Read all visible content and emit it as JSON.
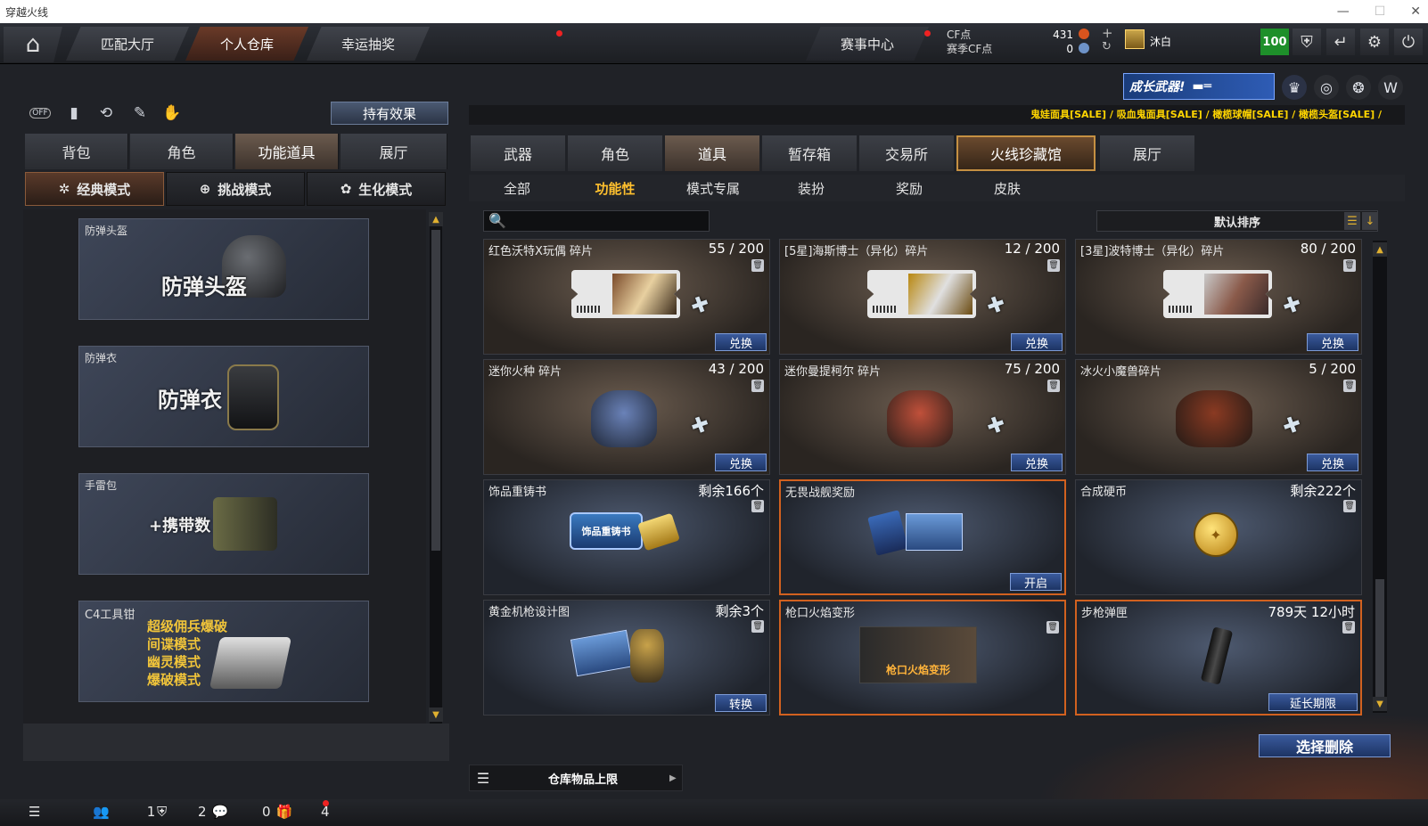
{
  "window": {
    "title": "穿越火线",
    "minimize": "—",
    "maximize": "☐",
    "close": "✕"
  },
  "nav": {
    "tabs": [
      "匹配大厅",
      "个人仓库",
      "幸运抽奖"
    ],
    "event": "赛事中心",
    "cf_label": "CF点",
    "season_cf_label": "赛季CF点",
    "cf_value": "431",
    "season_cf_value": "0",
    "username": "沐白",
    "level_badge": "100"
  },
  "left": {
    "toggle_off": "OFF",
    "hold_effect": "持有效果",
    "tabs": [
      "背包",
      "角色",
      "功能道具",
      "展厅"
    ],
    "modes": [
      "经典模式",
      "挑战模式",
      "生化模式"
    ],
    "items": [
      {
        "name": "防弹头盔",
        "art": "防弹头盔"
      },
      {
        "name": "防弹衣",
        "art": "防弹衣"
      },
      {
        "name": "手雷包",
        "art": "+携带数"
      },
      {
        "name": "C4工具钳",
        "modes": [
          "超级佣兵爆破",
          "间谍模式",
          "幽灵模式",
          "爆破模式"
        ]
      }
    ]
  },
  "right": {
    "growth_banner": "成长武器!",
    "marquee": "鬼娃面具[SALE] / 吸血鬼面具[SALE] / 橄榄球帽[SALE] / 橄榄头盔[SALE] /",
    "tabs": [
      "武器",
      "角色",
      "道具",
      "暂存箱",
      "交易所",
      "火线珍藏馆",
      "展厅"
    ],
    "subtabs": [
      "全部",
      "功能性",
      "模式专属",
      "装扮",
      "奖励",
      "皮肤"
    ],
    "search_placeholder": "",
    "sort_label": "默认排序",
    "cards": [
      {
        "name": "红色沃特X玩偶 碎片",
        "count": "55 / 200",
        "action": "兑换"
      },
      {
        "name": "[5星]海斯博士（异化）碎片",
        "count": "12 / 200",
        "action": "兑换"
      },
      {
        "name": "[3星]波特博士（异化）碎片",
        "count": "80 / 200",
        "action": "兑换"
      },
      {
        "name": "迷你火种 碎片",
        "count": "43 / 200",
        "action": "兑换"
      },
      {
        "name": "迷你曼提柯尔 碎片",
        "count": "75 / 200",
        "action": "兑换"
      },
      {
        "name": "冰火小魔兽碎片",
        "count": "5 / 200",
        "action": "兑换"
      },
      {
        "name": "饰品重铸书",
        "count": "剩余166个",
        "action": "",
        "art": "饰品重铸书"
      },
      {
        "name": "无畏战舰奖励",
        "count": "",
        "action": "开启"
      },
      {
        "name": "合成硬币",
        "count": "剩余222个",
        "action": ""
      },
      {
        "name": "黄金机枪设计图",
        "count": "剩余3个",
        "action": "转换"
      },
      {
        "name": "枪口火焰变形",
        "count": "",
        "action": "",
        "art": "枪口火焰变形"
      },
      {
        "name": "步枪弹匣",
        "count": "789天 12小时",
        "action": "延长期限"
      }
    ],
    "delete_button": "选择删除",
    "capacity_label": "仓库物品上限"
  },
  "statusbar": {
    "friends": "1",
    "clan": "2",
    "messages": "0",
    "gifts": "4"
  },
  "colors": {
    "accent": "#ffc02e",
    "marquee": "#ffd500",
    "button_blue": "#2b4a86",
    "highlight_orange": "#d2611f"
  }
}
